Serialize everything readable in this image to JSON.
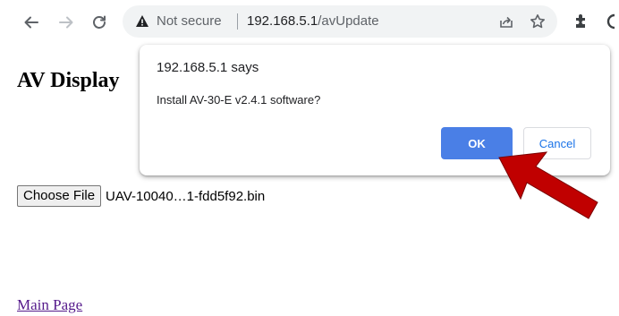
{
  "browser": {
    "security_label": "Not secure",
    "url_host": "192.168.5.1",
    "url_path": "/avUpdate"
  },
  "page": {
    "title": "AV Display",
    "choose_file_label": "Choose File",
    "file_name": "UAV-10040…1-fdd5f92.bin",
    "main_link": "Main Page"
  },
  "dialog": {
    "origin": "192.168.5.1 says",
    "message": "Install AV-30-E v2.4.1 software?",
    "ok_label": "OK",
    "cancel_label": "Cancel"
  },
  "colors": {
    "ok_button": "#4a7fe6",
    "cancel_text": "#1a73e8",
    "annotation_arrow": "#c00000",
    "link_visited": "#551a8b"
  },
  "icons": [
    "back-arrow-icon",
    "forward-arrow-icon",
    "reload-icon",
    "warning-icon",
    "share-icon",
    "bookmark-star-icon",
    "extensions-icon",
    "profile-icon"
  ]
}
